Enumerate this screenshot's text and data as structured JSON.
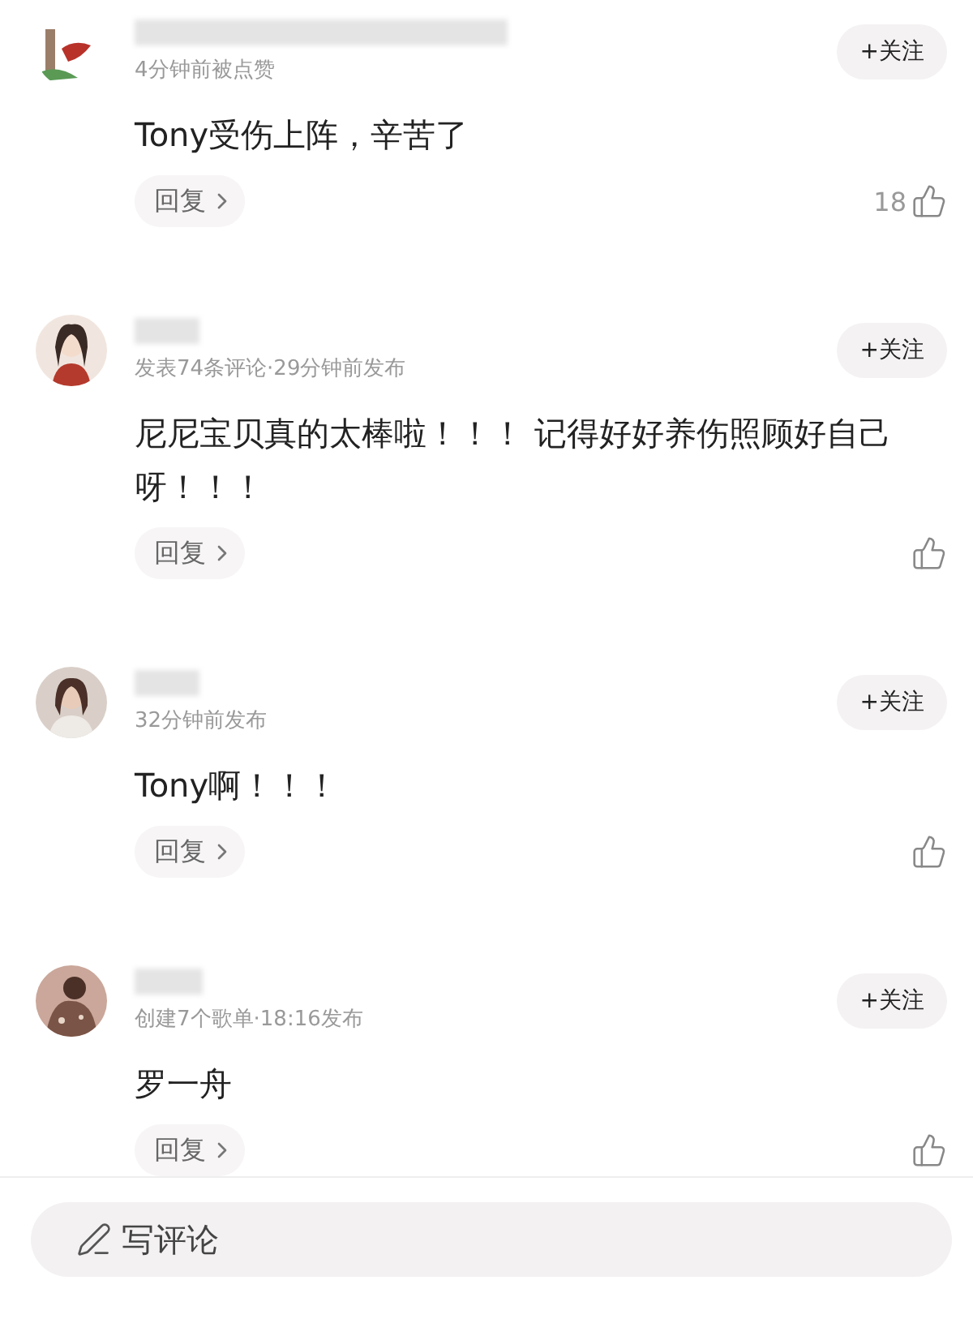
{
  "comments": [
    {
      "meta": "4分钟前被点赞",
      "text": "Tony受伤上阵，辛苦了",
      "follow": "+关注",
      "reply": "回复",
      "likes": "18"
    },
    {
      "meta": "发表74条评论·29分钟前发布",
      "text": "尼尼宝贝真的太棒啦！！！ 记得好好养伤照顾好自己呀！！！",
      "follow": "+关注",
      "reply": "回复"
    },
    {
      "meta": "32分钟前发布",
      "text": "Tony啊！！！",
      "follow": "+关注",
      "reply": "回复"
    },
    {
      "meta": "创建7个歌单·18:16发布",
      "text": "罗一舟",
      "follow": "+关注",
      "reply": "回复"
    }
  ],
  "composer": {
    "placeholder": "写评论"
  }
}
